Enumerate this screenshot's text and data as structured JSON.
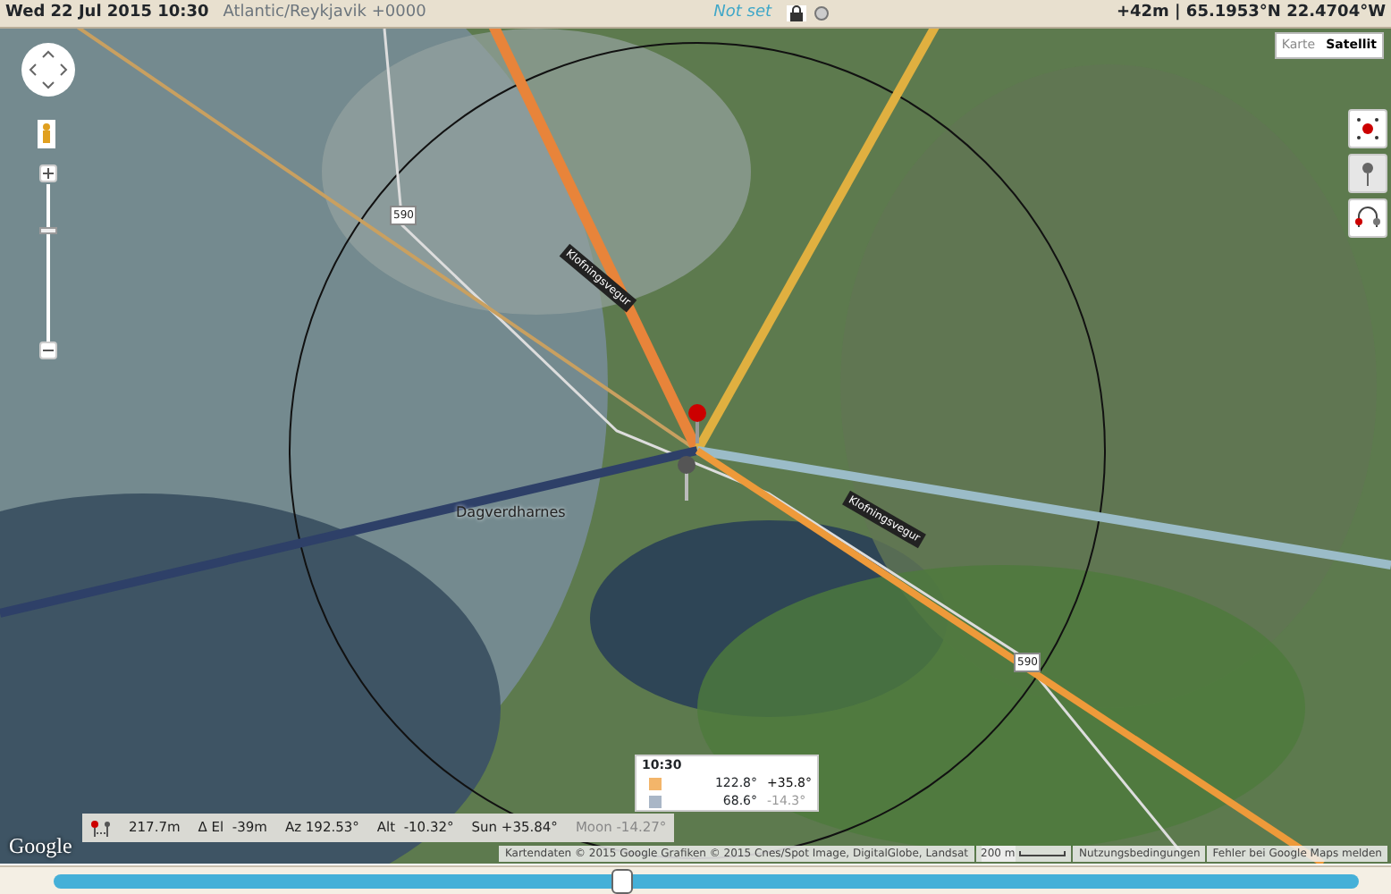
{
  "top_bar": {
    "datetime": "Wed 22 Jul 2015 10:30",
    "timezone": "Atlantic/Reykjavik +0000",
    "elevation_setting": "Not set",
    "position": "+42m | 65.1953°N 22.4704°W"
  },
  "map_type": [
    {
      "label": "Karte",
      "selected": false
    },
    {
      "label": "Satellit",
      "selected": true
    }
  ],
  "zoom_slider": {
    "level": 0.7
  },
  "map_labels": [
    {
      "text": "590"
    },
    {
      "text": "Klofningsvegur"
    },
    {
      "text": "Dagverdharnes"
    },
    {
      "text": "Klofningsvegur"
    },
    {
      "text": "590"
    }
  ],
  "rays": [
    {
      "color": "#c9a060"
    },
    {
      "color": "#e8843a"
    },
    {
      "color": "#e0b040"
    },
    {
      "color": "#2e4068"
    },
    {
      "color": "#9bbcc8"
    },
    {
      "color": "#ee9a3a"
    }
  ],
  "legend": {
    "time": "10:30",
    "rows": [
      {
        "color": "#f3b56a",
        "azimuth": "122.8°",
        "altitude": "+35.8°",
        "below_horizon": false
      },
      {
        "color": "#a9b6c6",
        "azimuth": "68.6°",
        "altitude": "-14.3°",
        "below_horizon": true
      }
    ]
  },
  "info_bar": [
    {
      "text": "217.7m",
      "dimmed": false
    },
    {
      "text": "Δ El  -39m",
      "dimmed": false
    },
    {
      "text": "Az 192.53°",
      "dimmed": false
    },
    {
      "text": "Alt  -10.32°",
      "dimmed": false
    },
    {
      "text": "Sun +35.84°",
      "dimmed": false
    },
    {
      "text": "Moon -14.27°",
      "dimmed": true
    }
  ],
  "logo": "Google",
  "attribution": {
    "data": "Kartendaten © 2015 Google Grafiken © 2015 Cnes/Spot Image, DigitalGlobe, Landsat",
    "scale": "200 m",
    "terms": "Nutzungsbedingungen",
    "report": "Fehler bei Google Maps melden"
  },
  "time_slider": {
    "level": 0.436
  }
}
